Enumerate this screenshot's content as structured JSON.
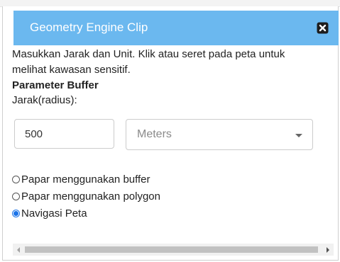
{
  "dialog": {
    "title": "Geometry Engine Clip",
    "close_icon": "close-square-icon",
    "header_color": "#6bb8ef",
    "instructions_line1": "Masukkan Jarak dan Unit. Klik atau seret pada peta untuk",
    "instructions_line2": "melihat kawasan sensitif.",
    "section_heading": "Parameter Buffer",
    "distance_label": "Jarak(radius):",
    "distance_value": "500",
    "unit_selected": "Meters",
    "options": [
      {
        "label": "Papar menggunakan buffer",
        "checked": false
      },
      {
        "label": "Papar menggunakan polygon",
        "checked": false
      },
      {
        "label": "Navigasi Peta",
        "checked": true
      }
    ],
    "accent_color": "#1a73e8"
  }
}
